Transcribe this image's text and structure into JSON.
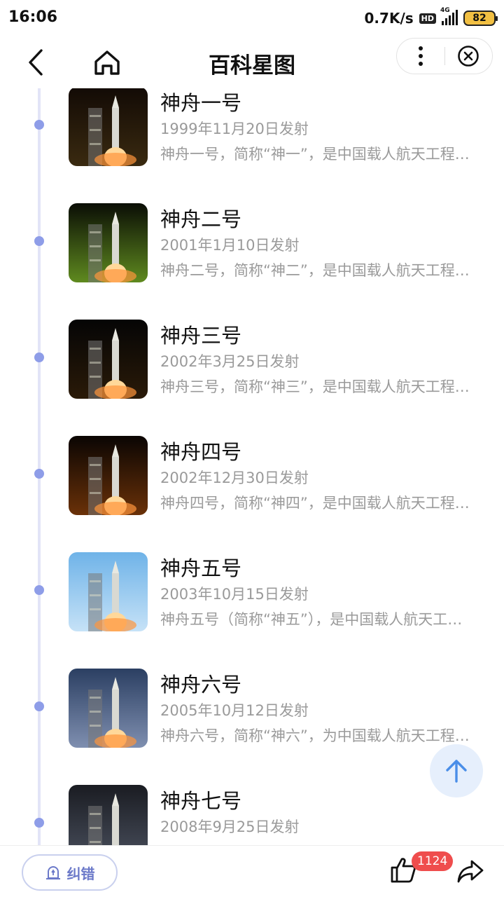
{
  "status_bar": {
    "time": "16:06",
    "net_speed": "0.7K/s",
    "hd": "HD",
    "network": "4G",
    "battery": "82"
  },
  "header": {
    "title": "百科星图",
    "icons": [
      "back-icon",
      "home-icon",
      "more-icon",
      "close-circle-icon"
    ]
  },
  "timeline": {
    "items": [
      {
        "title": "神舟一号",
        "date": "1999年11月20日发射",
        "desc": "神舟一号，简称“神一”，是中国载人航天工程的第一艘试验飞船",
        "thumb_colors": [
          "#120a05",
          "#3a2a10"
        ]
      },
      {
        "title": "神舟二号",
        "date": "2001年1月10日发射",
        "desc": "神舟二号，简称“神二”，是中国载人航天工程的第二艘无人试验飞船",
        "thumb_colors": [
          "#0a0d05",
          "#5f8a1f"
        ]
      },
      {
        "title": "神舟三号",
        "date": "2002年3月25日发射",
        "desc": "神舟三号，简称“神三”，是中国载人航天工程的第三艘无人试验飞船",
        "thumb_colors": [
          "#050505",
          "#2a1a08"
        ]
      },
      {
        "title": "神舟四号",
        "date": "2002年12月30日发射",
        "desc": "神舟四号，简称“神四”，是中国载人航天工程的第四艘无人试验飞船",
        "thumb_colors": [
          "#0a0503",
          "#6a3108"
        ]
      },
      {
        "title": "神舟五号",
        "date": "2003年10月15日发射",
        "desc": "神舟五号（简称“神五”），是中国载人航天工程发射的第五艘飞船",
        "thumb_colors": [
          "#6fb3e8",
          "#c6e2f7"
        ]
      },
      {
        "title": "神舟六号",
        "date": "2005年10月12日发射",
        "desc": "神舟六号，简称“神六”，为中国载人航天工程发射的第六艘飞船",
        "thumb_colors": [
          "#2b3f62",
          "#7f8fb0"
        ]
      },
      {
        "title": "神舟七号",
        "date": "2008年9月25日发射",
        "desc": "",
        "thumb_colors": [
          "#1a1c22",
          "#4a505e"
        ]
      }
    ]
  },
  "bottom_bar": {
    "report_label": "纠错",
    "like_count": "1124",
    "icons": [
      "report-icon",
      "thumb-up-icon",
      "share-icon"
    ]
  },
  "colors": {
    "timeline_line": "#e2e4f7",
    "timeline_dot": "#8e9de8",
    "accent": "#6b79c9",
    "badge_red": "#ef4d4d"
  }
}
